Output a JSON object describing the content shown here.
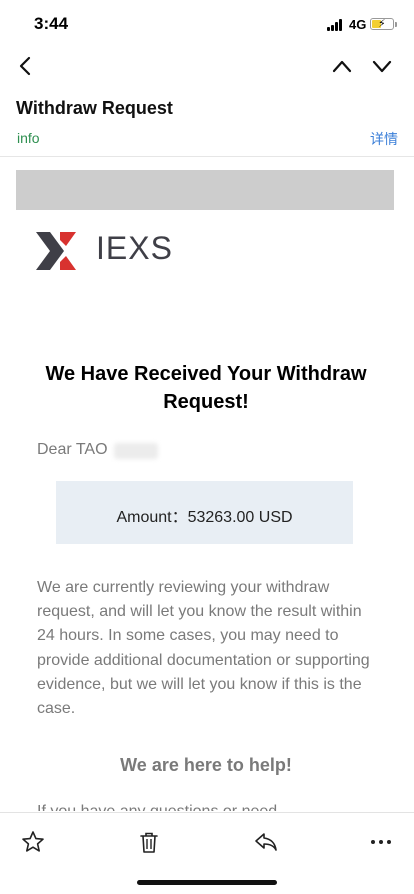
{
  "status_bar": {
    "time": "3:44",
    "network": "4G",
    "battery_level": 0.45,
    "battery_color": "#f3cf32"
  },
  "nav": {
    "icons": [
      "chevron-left-icon",
      "chevron-up-icon",
      "chevron-down-icon"
    ]
  },
  "email_header": {
    "subject": "Withdraw Request",
    "sender": "info",
    "details_link": "详情",
    "sender_color": "#2e8f50",
    "link_color": "#3b7fd8"
  },
  "email_body": {
    "logo_text": "IEXS",
    "headline": "We Have Received Your Withdraw Request!",
    "greeting": "Dear TAO",
    "amount": "Amount：53263.00 USD",
    "paragraph": "We are currently reviewing your withdraw request, and will let you know the result within 24 hours. In some cases, you may need to provide additional documentation or supporting evidence, but we will let you know if this is the case.",
    "help_heading": "We are here to help!",
    "cutoff_text": "If you have any questions or need"
  },
  "toolbar": {
    "icons": [
      "star-icon",
      "trash-icon",
      "reply-icon",
      "more-icon"
    ]
  }
}
